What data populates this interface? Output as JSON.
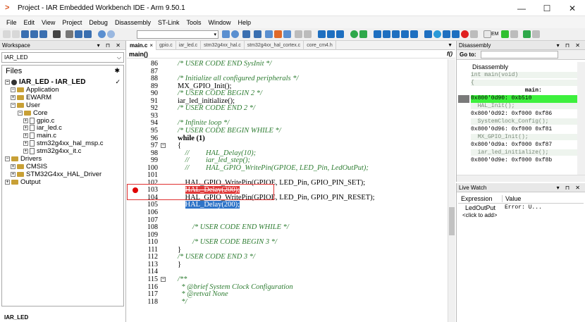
{
  "window": {
    "title": "Project - IAR Embedded Workbench IDE - Arm 9.50.1",
    "minimize": "—",
    "maximize": "☐",
    "close": "✕"
  },
  "menu": [
    "File",
    "Edit",
    "View",
    "Project",
    "Debug",
    "Disassembly",
    "ST-Link",
    "Tools",
    "Window",
    "Help"
  ],
  "toolbar": {
    "combo_value": "",
    "em_label": "EM"
  },
  "workspace": {
    "title": "Workspace",
    "config": "IAR_LED",
    "files_label": "Files",
    "tree": [
      {
        "label": "IAR_LED - IAR_LED",
        "type": "project",
        "bold": true,
        "check": "✓"
      },
      {
        "label": "Application",
        "type": "folder"
      },
      {
        "label": "EWARM",
        "type": "folder"
      },
      {
        "label": "User",
        "type": "folder"
      },
      {
        "label": "Core",
        "type": "folder"
      },
      {
        "label": "gpio.c",
        "type": "file"
      },
      {
        "label": "iar_led.c",
        "type": "file"
      },
      {
        "label": "main.c",
        "type": "file"
      },
      {
        "label": "stm32g4xx_hal_msp.c",
        "type": "file"
      },
      {
        "label": "stm32g4xx_it.c",
        "type": "file"
      },
      {
        "label": "Drivers",
        "type": "folder"
      },
      {
        "label": "CMSIS",
        "type": "folder"
      },
      {
        "label": "STM32G4xx_HAL_Driver",
        "type": "folder"
      },
      {
        "label": "Output",
        "type": "folder"
      }
    ],
    "bottom_tab": "IAR_LED"
  },
  "editor": {
    "tabs": [
      "main.c",
      "gpio.c",
      "iar_led.c",
      "stm32g4xx_hal.c",
      "stm32g4xx_hal_cortex.c",
      "core_cm4.h"
    ],
    "active_tab_close": "×",
    "function_bar": "main()",
    "function_icon": "f()",
    "lines": [
      {
        "n": "86",
        "text": "/* USER CODE END SysInit */",
        "cls": "cm"
      },
      {
        "n": "87",
        "text": ""
      },
      {
        "n": "88",
        "text": "/* Initialize all configured peripherals */",
        "cls": "cm"
      },
      {
        "n": "89",
        "text": "MX_GPIO_Init();"
      },
      {
        "n": "90",
        "text": "/* USER CODE BEGIN 2 */",
        "cls": "cm"
      },
      {
        "n": "91",
        "text": "iar_led_initialize();"
      },
      {
        "n": "92",
        "text": "/* USER CODE END 2 */",
        "cls": "cm"
      },
      {
        "n": "93",
        "text": ""
      },
      {
        "n": "94",
        "text": "/* Infinite loop */",
        "cls": "cm"
      },
      {
        "n": "95",
        "text": "/* USER CODE BEGIN WHILE */",
        "cls": "cm"
      },
      {
        "n": "96",
        "text": "while (1)",
        "cls": "kw"
      },
      {
        "n": "97",
        "text": "{"
      },
      {
        "n": "98",
        "text": "    //         HAL_Delay(10);",
        "cls": "cm"
      },
      {
        "n": "99",
        "text": "    //         iar_led_step();",
        "cls": "cm"
      },
      {
        "n": "100",
        "text": "    //         HAL_GPIO_WritePin(GPIOE, LED_Pin, LedOutPut);",
        "cls": "cm"
      },
      {
        "n": "101",
        "text": ""
      },
      {
        "n": "102",
        "text": "    HAL_GPIO_WritePin(GPIOE, LED_Pin, GPIO_PIN_SET);"
      },
      {
        "n": "103",
        "text": "    HAL_Delay(200);",
        "hl": "red"
      },
      {
        "n": "104",
        "text": "    HAL_GPIO_WritePin(GPIOE, LED_Pin, GPIO_PIN_RESET);"
      },
      {
        "n": "105",
        "text": "    HAL_Delay(200);",
        "hl": "blue"
      },
      {
        "n": "106",
        "text": ""
      },
      {
        "n": "107",
        "text": ""
      },
      {
        "n": "108",
        "text": "        /* USER CODE END WHILE */",
        "cls": "cm"
      },
      {
        "n": "109",
        "text": ""
      },
      {
        "n": "110",
        "text": "        /* USER CODE BEGIN 3 */",
        "cls": "cm"
      },
      {
        "n": "111",
        "text": "}"
      },
      {
        "n": "112",
        "text": "/* USER CODE END 3 */",
        "cls": "cm"
      },
      {
        "n": "113",
        "text": "}"
      },
      {
        "n": "114",
        "text": ""
      },
      {
        "n": "115",
        "text": "/**",
        "cls": "cm"
      },
      {
        "n": "116",
        "text": "  * @brief System Clock Configuration",
        "cls": "cm"
      },
      {
        "n": "117",
        "text": "  * @retval None",
        "cls": "cm"
      },
      {
        "n": "118",
        "text": "  */",
        "cls": "cm"
      }
    ]
  },
  "disassembly": {
    "title": "Disassembly",
    "goto_label": "Go to:",
    "header": "Disassembly",
    "lines": [
      {
        "text": "int main(void)",
        "src": true
      },
      {
        "text": "{",
        "src": true
      },
      {
        "text": "                main:",
        "src": false
      },
      {
        "text": "0x800'0d90: 0xb510",
        "src": false,
        "current": true
      },
      {
        "text": "  HAL_Init();",
        "src": true
      },
      {
        "text": "0x800'0d92: 0xf000 0xf86",
        "src": false
      },
      {
        "text": "  SystemClock_Config();",
        "src": true
      },
      {
        "text": "0x800'0d96: 0xf000 0xf81",
        "src": false
      },
      {
        "text": "  MX_GPIO_Init();",
        "src": true
      },
      {
        "text": "0x800'0d9a: 0xf000 0xf87",
        "src": false
      },
      {
        "text": "  iar_led_initialize();",
        "src": true
      },
      {
        "text": "0x800'0d9e: 0xf000 0xf8b",
        "src": false
      }
    ]
  },
  "live_watch": {
    "title": "Live Watch",
    "col_expression": "Expression",
    "col_value": "Value",
    "rows": [
      {
        "expr": "LedOutPut",
        "value": "Error: U..."
      }
    ],
    "add_label": "<click to add>"
  },
  "colors": {
    "breakpoint": "#e00000",
    "current_line": "#3df03d",
    "selection": "#2f74c8",
    "comment": "#2e7d32"
  }
}
